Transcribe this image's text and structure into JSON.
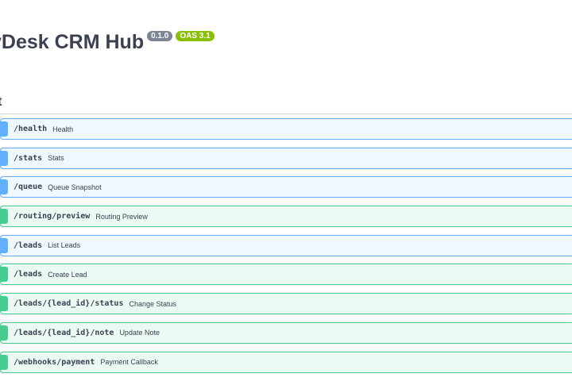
{
  "header": {
    "title": "vDesk CRM Hub",
    "version_badge": "0.1.0",
    "oas_badge": "OAS 3.1"
  },
  "section": {
    "title": "lt"
  },
  "colors": {
    "get": "#61affe",
    "post": "#49cc90",
    "version_badge": "#7d8492",
    "oas_badge": "#89bf04"
  },
  "operations": [
    {
      "method": "get",
      "path": "/health",
      "summary": "Health"
    },
    {
      "method": "get",
      "path": "/stats",
      "summary": "Stats"
    },
    {
      "method": "get",
      "path": "/queue",
      "summary": "Queue Snapshot"
    },
    {
      "method": "post",
      "path": "/routing/preview",
      "summary": "Routing Preview"
    },
    {
      "method": "get",
      "path": "/leads",
      "summary": "List Leads"
    },
    {
      "method": "post",
      "path": "/leads",
      "summary": "Create Lead"
    },
    {
      "method": "post",
      "path": "/leads/{lead_id}/status",
      "summary": "Change Status"
    },
    {
      "method": "post",
      "path": "/leads/{lead_id}/note",
      "summary": "Update Note"
    },
    {
      "method": "post",
      "path": "/webhooks/payment",
      "summary": "Payment Callback"
    }
  ]
}
